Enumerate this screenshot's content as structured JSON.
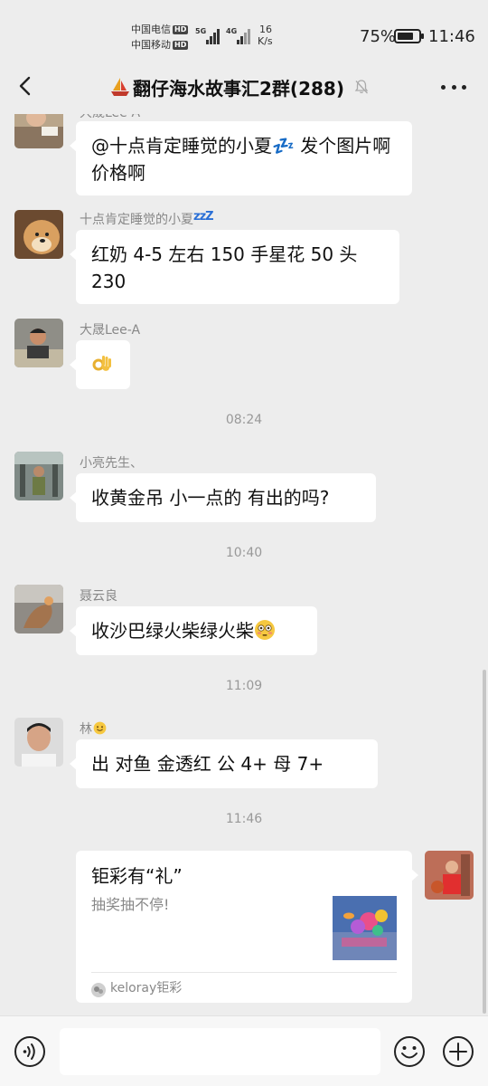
{
  "status_bar": {
    "carrier_1": "中国电信",
    "carrier_2": "中国移动",
    "hd_badge": "HD",
    "net_1": "5G",
    "net_2": "4G",
    "speed_value": "16",
    "speed_unit": "K/s",
    "battery_percent": "75%",
    "battery_level": 0.75,
    "time": "11:46"
  },
  "nav": {
    "title": "翻仔海水故事汇2群(288)"
  },
  "messages": [
    {
      "sender": "大晟Lee-A",
      "text": "@十点肯定睡觉的小夏💤 发个图片啊价格啊"
    },
    {
      "sender": "十点肯定睡觉的小夏",
      "text": "红奶 4-5 左右  150  手星花 50 头 230"
    },
    {
      "sender": "大晟Lee-A",
      "text": "👌"
    },
    {
      "time": "08:24"
    },
    {
      "sender": "小亮先生、",
      "text": "收黄金吊 小一点的 有出的吗?"
    },
    {
      "time": "10:40"
    },
    {
      "sender": "聂云良",
      "text": "收沙巴绿火柴绿火柴"
    },
    {
      "time": "11:09"
    },
    {
      "sender": "林",
      "text": "出 对鱼 金透红 公 4+  母 7+"
    },
    {
      "time": "11:46"
    }
  ],
  "card": {
    "title": "钜彩有“礼”",
    "description": "抽奖抽不停!",
    "source": "keloray钜彩"
  },
  "colors": {
    "background": "#ededed",
    "bubble": "#ffffff",
    "zzz": "#2a6fd6",
    "timestamp": "#999999"
  }
}
